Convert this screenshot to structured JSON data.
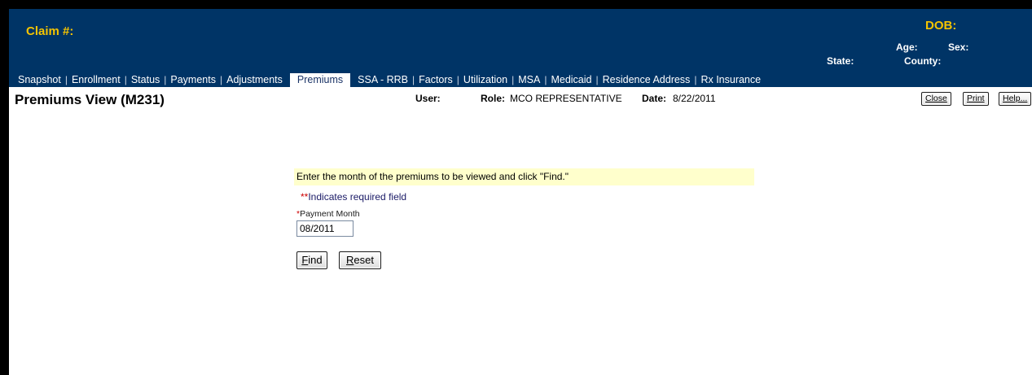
{
  "header": {
    "claim_label": "Claim #:",
    "dob_label": "DOB:",
    "age_label": "Age:",
    "sex_label": "Sex:",
    "state_label": "State:",
    "county_label": "County:",
    "background_color": "#003466",
    "accent_color": "#f5c400"
  },
  "tabs": [
    {
      "label": "Snapshot",
      "active": false
    },
    {
      "label": "Enrollment",
      "active": false
    },
    {
      "label": "Status",
      "active": false
    },
    {
      "label": "Payments",
      "active": false
    },
    {
      "label": "Adjustments",
      "active": false
    },
    {
      "label": "Premiums",
      "active": true
    },
    {
      "label": "SSA - RRB",
      "active": false
    },
    {
      "label": "Factors",
      "active": false
    },
    {
      "label": "Utilization",
      "active": false
    },
    {
      "label": "MSA",
      "active": false
    },
    {
      "label": "Medicaid",
      "active": false
    },
    {
      "label": "Residence Address",
      "active": false
    },
    {
      "label": "Rx Insurance",
      "active": false
    }
  ],
  "titlebar": {
    "title": "Premiums View (M231)",
    "user_label": "User:",
    "role_label": "Role:",
    "role_value": "MCO REPRESENTATIVE",
    "date_label": "Date:",
    "date_value": "8/22/2011",
    "close_label": "Close",
    "print_label": "Print",
    "help_label": "Help..."
  },
  "form": {
    "instruction": "Enter the month of the premiums to be viewed and click \"Find.\"",
    "required_star": "*",
    "required_note": "Indicates required field",
    "field_star": "*",
    "field_label": "Payment Month",
    "field_value": "08/2011",
    "find_label": "Find",
    "reset_label": "Reset"
  }
}
